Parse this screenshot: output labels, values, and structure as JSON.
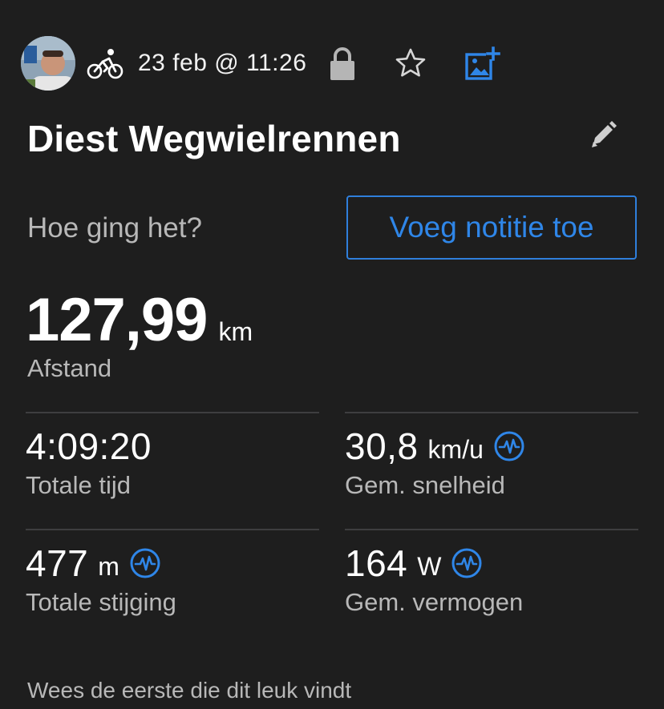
{
  "header": {
    "avatar_icon": "user-avatar-photo",
    "activity_icon": "road-cycling-icon",
    "date": "23 feb @ 11:26",
    "privacy_icon": "lock-icon",
    "favorite_icon": "star-icon",
    "add_photo_icon": "add-photo-icon"
  },
  "activity": {
    "title": "Diest Wegwielrennen",
    "edit_icon": "pencil-icon"
  },
  "feedback": {
    "prompt": "Hoe ging het?",
    "note_button": "Voeg notitie toe"
  },
  "distance": {
    "value": "127,99",
    "unit": "km",
    "label": "Afstand"
  },
  "stats": [
    {
      "value": "4:09:20",
      "unit": "",
      "label": "Totale tijd",
      "badge": false
    },
    {
      "value": "30,8",
      "unit": "km/u",
      "label": "Gem. snelheid",
      "badge": true
    },
    {
      "value": "477",
      "unit": "m",
      "label": "Totale stijging",
      "badge": true
    },
    {
      "value": "164",
      "unit": "W",
      "label": "Gem. vermogen",
      "badge": true
    }
  ],
  "social": {
    "likes_text": "Wees de eerste die dit leuk vindt"
  },
  "colors": {
    "background": "#1e1e1e",
    "accent_blue": "#2f86e8",
    "secondary_text": "#b8b8b8",
    "divider": "#3e3e40"
  }
}
